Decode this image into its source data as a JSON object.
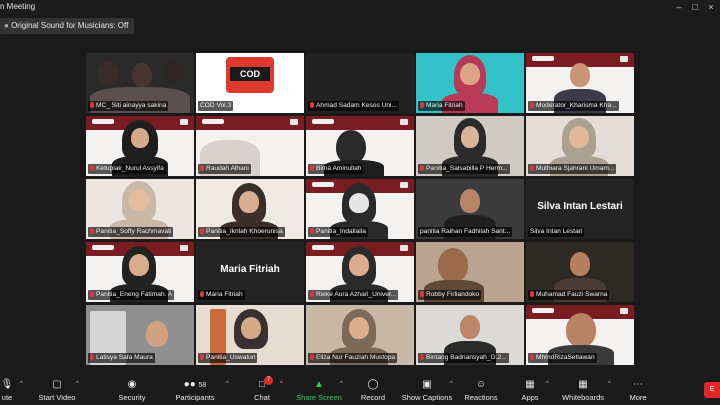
{
  "window": {
    "title": "n Meeting",
    "controls": [
      "minimize",
      "maximize",
      "close"
    ]
  },
  "info_badge": "Original Sound for Musicians: Off",
  "participants": [
    {
      "name": "MC_ Siti ainayya sakina",
      "muted": true,
      "kind": "video",
      "active": true
    },
    {
      "name": "COD Vol.3",
      "muted": false,
      "kind": "logo",
      "logo_text": "COD"
    },
    {
      "name": "Ahmad Sadam Kesos Uni...",
      "muted": true,
      "kind": "dark"
    },
    {
      "name": "Maria Fitriah",
      "muted": true,
      "kind": "video"
    },
    {
      "name": "Moderator_Kharisma Kha...",
      "muted": true,
      "kind": "banner"
    },
    {
      "name": "Ketuplak_Nurul Assyifa",
      "muted": true,
      "kind": "banner"
    },
    {
      "name": "Raudah Alhani",
      "muted": true,
      "kind": "banner"
    },
    {
      "name": "Bima Aminullah",
      "muted": true,
      "kind": "banner"
    },
    {
      "name": "Panitia_Salsabilla P Herm...",
      "muted": true,
      "kind": "video"
    },
    {
      "name": "Muthiara Sjahrani Umam...",
      "muted": true,
      "kind": "video"
    },
    {
      "name": "Panitia_Soffy Rachmavati",
      "muted": true,
      "kind": "video"
    },
    {
      "name": "Panitia_Ikrilah Khoerunisa",
      "muted": true,
      "kind": "video"
    },
    {
      "name": "Panitia_Indallaila",
      "muted": true,
      "kind": "banner"
    },
    {
      "name": "panitia Raihan Fadhilah Sant...",
      "muted": false,
      "kind": "video"
    },
    {
      "name": "Silva Intan Lestari",
      "muted": false,
      "kind": "name_only",
      "display_name": "Silva Intan Lestari"
    },
    {
      "name": "Panitia_Eneng Fatimah. A",
      "muted": true,
      "kind": "banner"
    },
    {
      "name": "Maria Fitriah",
      "muted": true,
      "kind": "name_only",
      "display_name": "Maria Fitriah"
    },
    {
      "name": "Rieke Aura Azhari_Univer...",
      "muted": true,
      "kind": "banner"
    },
    {
      "name": "Robby Firliandoko",
      "muted": true,
      "kind": "video"
    },
    {
      "name": "Muhamad Fauzi Swarna",
      "muted": true,
      "kind": "video"
    },
    {
      "name": "Latisya Safa Maura",
      "muted": true,
      "kind": "video"
    },
    {
      "name": "Panitia_Uswatun",
      "muted": true,
      "kind": "video"
    },
    {
      "name": "Eliza Nur Fauziah Mustopa",
      "muted": true,
      "kind": "video"
    },
    {
      "name": "Bintang Badriansyah_G.2...",
      "muted": true,
      "kind": "video"
    },
    {
      "name": "MhmdRizaSetiawan",
      "muted": true,
      "kind": "banner"
    }
  ],
  "toolbar": {
    "items": [
      {
        "id": "mute",
        "label": "ute",
        "icon": "microphone-icon"
      },
      {
        "id": "video",
        "label": "Start Video",
        "icon": "video-off-icon"
      },
      {
        "id": "security",
        "label": "Security",
        "icon": "shield-icon"
      },
      {
        "id": "participants",
        "label": "Participants",
        "icon": "participants-icon",
        "count": "58"
      },
      {
        "id": "chat",
        "label": "Chat",
        "icon": "chat-icon",
        "badge": "7"
      },
      {
        "id": "share",
        "label": "Share Screen",
        "icon": "share-screen-icon"
      },
      {
        "id": "record",
        "label": "Record",
        "icon": "record-icon"
      },
      {
        "id": "captions",
        "label": "Show Captions",
        "icon": "cc-icon"
      },
      {
        "id": "reactions",
        "label": "Reactions",
        "icon": "smile-icon"
      },
      {
        "id": "apps",
        "label": "Apps",
        "icon": "apps-icon"
      },
      {
        "id": "whiteboards",
        "label": "Whiteboards",
        "icon": "whiteboard-icon"
      },
      {
        "id": "more",
        "label": "More",
        "icon": "more-icon"
      }
    ],
    "end_label": "E"
  },
  "colors": {
    "banner": "#7a1d22",
    "active_border": "#b6d644",
    "share_green": "#23d160",
    "end_red": "#e02828"
  }
}
